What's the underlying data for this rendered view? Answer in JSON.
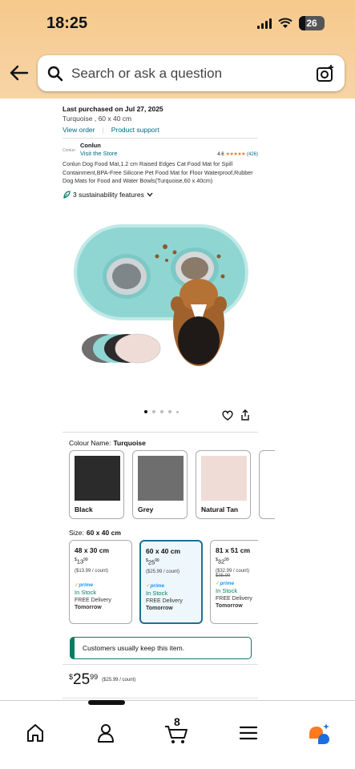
{
  "status_bar": {
    "time": "18:25",
    "battery": "26"
  },
  "search": {
    "placeholder": "Search or ask a question"
  },
  "order": {
    "last_purchased": "Last purchased on Jul 27, 2025",
    "variant": "Turquoise , 60 x 40 cm",
    "view_order": "View order",
    "product_support": "Product support"
  },
  "brand": {
    "logo_text": "Conlun",
    "name": "Conlun",
    "visit_store": "Visit the Store",
    "rating": "4.6",
    "stars": "★★★★★",
    "review_count": "(426)"
  },
  "product": {
    "title": "Conlun Dog Food Mat,1.2 cm Raised Edges Cat Food Mat for Spill Containment,BPA-Free Silicone Pet Food Mat for Floor Waterproof,Rubber Dog Mats for Food and Water Bowls(Turquoise,60 x 40cm)",
    "sustainability": "3 sustainability features"
  },
  "colour": {
    "label": "Colour Name:",
    "selected": "Turquoise",
    "options": [
      {
        "label": "Black",
        "color": "#2b2b2b"
      },
      {
        "label": "Grey",
        "color": "#6e6e6e"
      },
      {
        "label": "Natural Tan",
        "color": "#f0dcd6"
      }
    ]
  },
  "size": {
    "label": "Size:",
    "selected": "60 x 40 cm",
    "options": [
      {
        "dim": "48 x 30 cm",
        "price_whole": "13",
        "price_frac": "99",
        "unit": "($13.99 / count)",
        "was": "",
        "prime": "prime",
        "stock": "In Stock",
        "delivery": "FREE Delivery",
        "when": "Tomorrow"
      },
      {
        "dim": "60 x 40 cm",
        "price_whole": "25",
        "price_frac": "99",
        "unit": "($25.99 / count)",
        "was": "",
        "prime": "prime",
        "stock": "In Stock",
        "delivery": "FREE Delivery",
        "when": "Tomorrow"
      },
      {
        "dim": "81 x 51 cm",
        "price_whole": "32",
        "price_frac": "99",
        "unit": "($32.99 / count)",
        "was": "$35.99",
        "prime": "prime",
        "stock": "In Stock",
        "delivery": "FREE Delivery",
        "when": "Tomorrow"
      }
    ]
  },
  "keep_message": "Customers usually keep this item.",
  "price": {
    "currency": "$",
    "whole": "25",
    "fraction": "99",
    "unit": "($25.99 / count)"
  },
  "cart": {
    "count": "8"
  },
  "colors": {
    "accent_link": "#006a85",
    "stock_green": "#067d62",
    "prime_blue": "#1a98ff",
    "selected_border": "#1f6f95",
    "mat_turquoise": "#8fd6d3"
  }
}
